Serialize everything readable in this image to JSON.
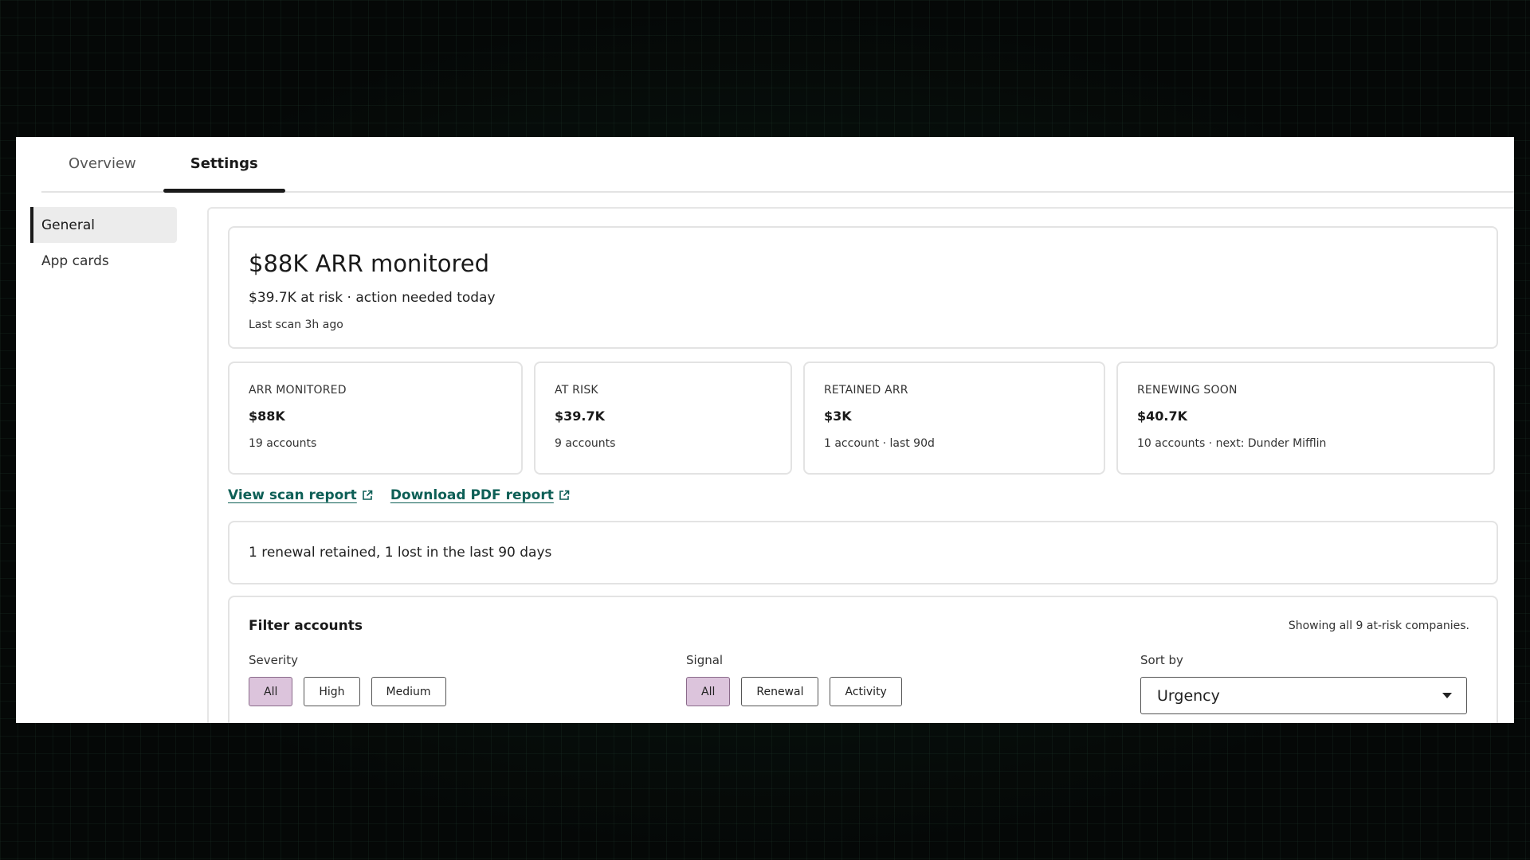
{
  "tabs": [
    {
      "label": "Overview"
    },
    {
      "label": "Settings"
    }
  ],
  "sidebar": {
    "items": [
      {
        "label": "General"
      },
      {
        "label": "App cards"
      }
    ]
  },
  "hero": {
    "title": "$88K ARR monitored",
    "subtitle": "$39.7K at risk · action needed today",
    "meta": "Last scan 3h ago"
  },
  "stats": [
    {
      "label": "ARR MONITORED",
      "value": "$88K",
      "note": "19 accounts"
    },
    {
      "label": "AT RISK",
      "value": "$39.7K",
      "note": "9 accounts"
    },
    {
      "label": "RETAINED ARR",
      "value": "$3K",
      "note": "1 account · last 90d"
    },
    {
      "label": "RENEWING SOON",
      "value": "$40.7K",
      "note": "10 accounts · next: Dunder Mifflin"
    }
  ],
  "links": {
    "scan_report": "View scan report",
    "pdf_report": "Download PDF report"
  },
  "summary": "1 renewal retained, 1 lost in the last 90 days",
  "filter": {
    "title": "Filter accounts",
    "count": "Showing all 9 at-risk companies.",
    "severity": {
      "label": "Severity",
      "options": [
        "All",
        "High",
        "Medium"
      ]
    },
    "signal": {
      "label": "Signal",
      "options": [
        "All",
        "Renewal",
        "Activity"
      ]
    },
    "sort": {
      "label": "Sort by",
      "value": "Urgency"
    }
  },
  "colors": {
    "accent_chip": "#dcc4dc",
    "link": "#0d5f56"
  },
  "icons": {
    "external": "external-link-icon",
    "caret": "chevron-down-icon"
  }
}
